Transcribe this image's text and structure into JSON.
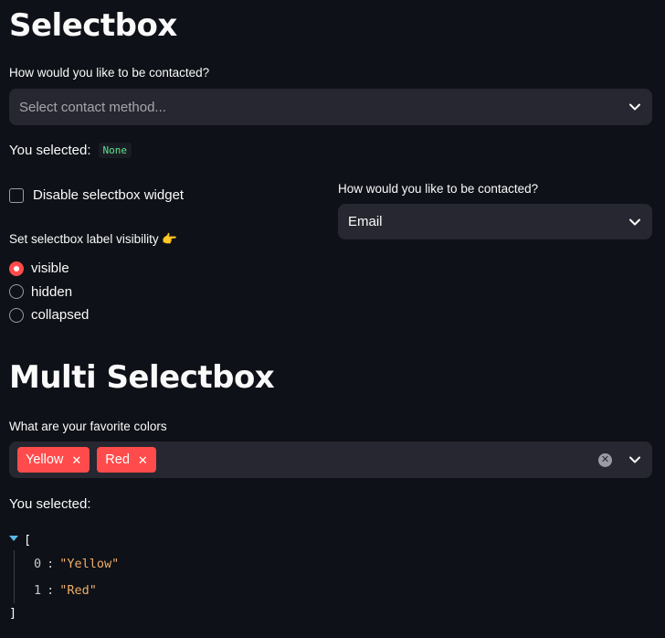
{
  "selectbox_section": {
    "title": "Selectbox",
    "contact_label": "How would you like to be contacted?",
    "contact_placeholder": "Select contact method...",
    "selected_prefix": "You selected:",
    "selected_value": "None",
    "disable_checkbox_label": "Disable selectbox widget",
    "visibility_label": "Set selectbox label visibility 👉",
    "visibility_options": [
      "visible",
      "hidden",
      "collapsed"
    ],
    "visibility_selected": "visible",
    "contact2_label": "How would you like to be contacted?",
    "contact2_value": "Email"
  },
  "multiselect_section": {
    "title": "Multi Selectbox",
    "label": "What are your favorite colors",
    "selected_tags": [
      "Yellow",
      "Red"
    ],
    "selected_prefix": "You selected:",
    "json_open": "[",
    "json_close": "]",
    "json_items": [
      {
        "index": "0",
        "value": "\"Yellow\""
      },
      {
        "index": "1",
        "value": "\"Red\""
      }
    ]
  },
  "icons": {
    "dropdown": "chevron-down-icon",
    "clear": "clear-all-icon",
    "tag_remove": "close-icon",
    "json_toggle": "caret-down-icon"
  },
  "colors": {
    "background": "#0e1117",
    "widget": "#262730",
    "accent": "#ff4b4b",
    "code_green": "#5ce488",
    "json_string": "#f0ad6b"
  }
}
